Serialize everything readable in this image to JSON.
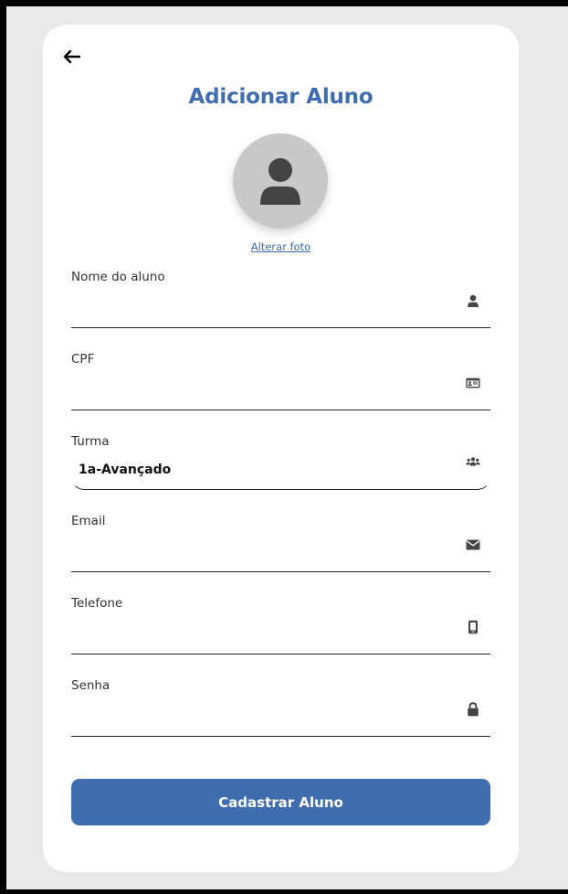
{
  "header": {
    "title": "Adicionar Aluno",
    "back_icon": "arrow-left-icon"
  },
  "avatar": {
    "icon": "user-silhouette-icon",
    "change_photo_label": "Alterar foto"
  },
  "fields": [
    {
      "label": "Nome do aluno",
      "value": "",
      "icon": "user-icon"
    },
    {
      "label": "CPF",
      "value": "",
      "icon": "id-card-icon"
    },
    {
      "label": "Turma",
      "value": "1a-Avançado",
      "icon": "users-group-icon"
    },
    {
      "label": "Email",
      "value": "",
      "icon": "envelope-icon"
    },
    {
      "label": "Telefone",
      "value": "",
      "icon": "mobile-phone-icon"
    },
    {
      "label": "Senha",
      "value": "",
      "icon": "lock-icon"
    }
  ],
  "submit": {
    "label": "Cadastrar Aluno"
  },
  "colors": {
    "accent": "#3f6db0",
    "background": "#e9e9e9",
    "card": "#ffffff",
    "avatar_bg": "#c8c8c8",
    "icon": "#444444"
  }
}
